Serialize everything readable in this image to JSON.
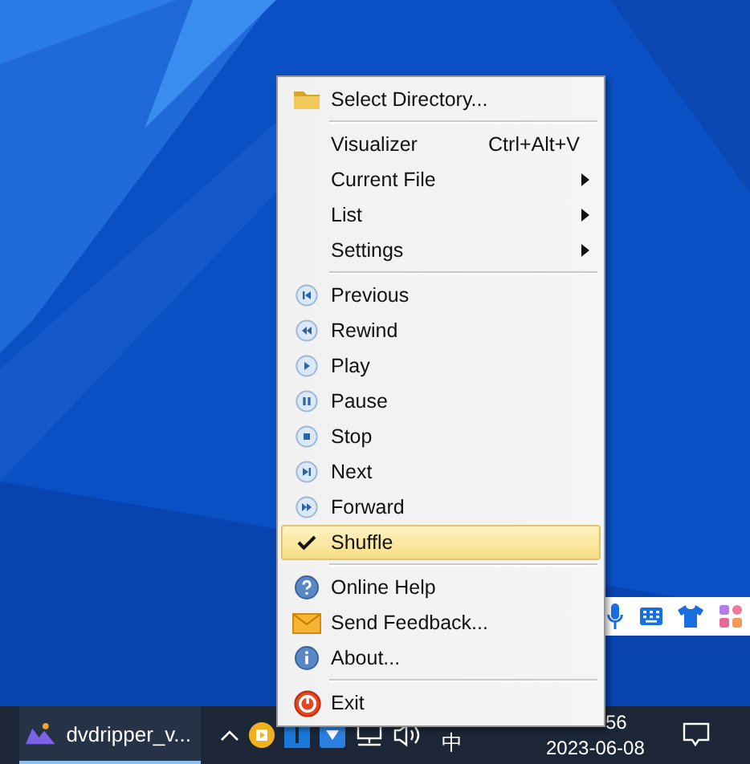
{
  "context_menu": {
    "items": [
      {
        "kind": "item",
        "label": "Select Directory...",
        "submenu": false,
        "checked": false,
        "selected": false
      },
      {
        "kind": "separator"
      },
      {
        "kind": "item",
        "label": "Visualizer",
        "shortcut": "Ctrl+Alt+V",
        "submenu": false,
        "checked": false,
        "selected": false
      },
      {
        "kind": "item",
        "label": "Current File",
        "submenu": true,
        "checked": false,
        "selected": false
      },
      {
        "kind": "item",
        "label": "List",
        "submenu": true,
        "checked": false,
        "selected": false
      },
      {
        "kind": "item",
        "label": "Settings",
        "submenu": true,
        "checked": false,
        "selected": false
      },
      {
        "kind": "separator"
      },
      {
        "kind": "item",
        "label": "Previous",
        "submenu": false,
        "checked": false,
        "selected": false
      },
      {
        "kind": "item",
        "label": "Rewind",
        "submenu": false,
        "checked": false,
        "selected": false
      },
      {
        "kind": "item",
        "label": "Play",
        "submenu": false,
        "checked": false,
        "selected": false
      },
      {
        "kind": "item",
        "label": "Pause",
        "submenu": false,
        "checked": false,
        "selected": false
      },
      {
        "kind": "item",
        "label": "Stop",
        "submenu": false,
        "checked": false,
        "selected": false
      },
      {
        "kind": "item",
        "label": "Next",
        "submenu": false,
        "checked": false,
        "selected": false
      },
      {
        "kind": "item",
        "label": "Forward",
        "submenu": false,
        "checked": false,
        "selected": false
      },
      {
        "kind": "item",
        "label": "Shuffle",
        "submenu": false,
        "checked": true,
        "selected": true
      },
      {
        "kind": "separator"
      },
      {
        "kind": "item",
        "label": "Online Help",
        "submenu": false,
        "checked": false,
        "selected": false
      },
      {
        "kind": "item",
        "label": "Send Feedback...",
        "submenu": false,
        "checked": false,
        "selected": false
      },
      {
        "kind": "item",
        "label": "About...",
        "submenu": false,
        "checked": false,
        "selected": false
      },
      {
        "kind": "separator"
      },
      {
        "kind": "item",
        "label": "Exit",
        "submenu": false,
        "checked": false,
        "selected": false
      }
    ]
  },
  "taskbar": {
    "app_button": {
      "label": "dvdripper_v...",
      "selected": true
    },
    "tray": {
      "input_method": "中",
      "clock_time": "56",
      "clock_date": "2023-06-08"
    }
  }
}
